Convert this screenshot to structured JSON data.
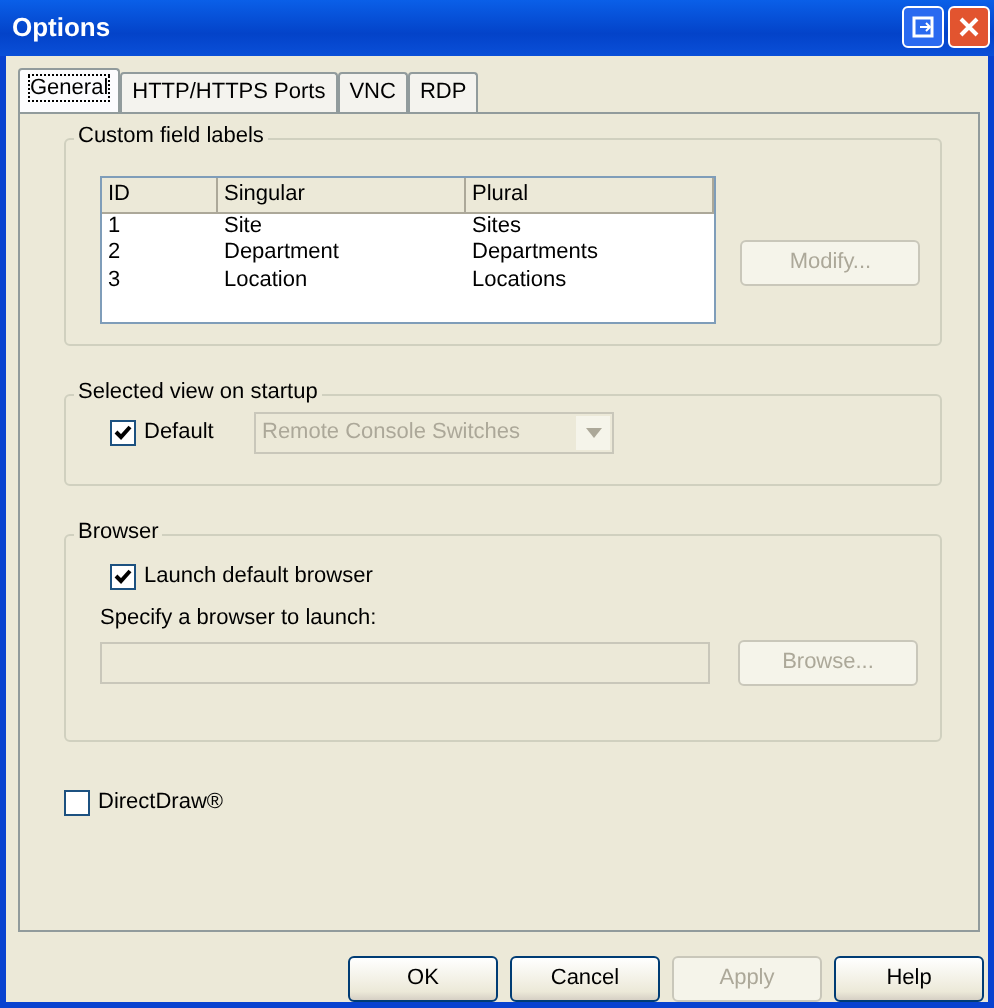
{
  "window": {
    "title": "Options"
  },
  "tabs": [
    {
      "label": "General",
      "selected": true
    },
    {
      "label": "HTTP/HTTPS Ports",
      "selected": false
    },
    {
      "label": "VNC",
      "selected": false
    },
    {
      "label": "RDP",
      "selected": false
    }
  ],
  "custom_field_labels": {
    "title": "Custom field labels",
    "columns": [
      "ID",
      "Singular",
      "Plural"
    ],
    "rows": [
      [
        "1",
        "Site",
        "Sites"
      ],
      [
        "2",
        "Department",
        "Departments"
      ],
      [
        "3",
        "Location",
        "Locations"
      ]
    ],
    "modify_button": {
      "label": "Modify...",
      "disabled": true
    }
  },
  "startup_view": {
    "title": "Selected view on startup",
    "default_checkbox": {
      "label": "Default",
      "checked": true
    },
    "view_select": {
      "value": "Remote Console Switches",
      "disabled": true
    }
  },
  "browser": {
    "title": "Browser",
    "launch_default": {
      "label": "Launch default browser",
      "checked": true
    },
    "specify_label": "Specify a browser to launch:",
    "path_field": {
      "disabled": true
    },
    "browse_button": {
      "label": "Browse...",
      "disabled": true
    }
  },
  "directdraw": {
    "label": "DirectDraw®",
    "checked": false
  },
  "buttons": [
    {
      "label": "OK",
      "disabled": false
    },
    {
      "label": "Cancel",
      "disabled": false
    },
    {
      "label": "Apply",
      "disabled": true
    },
    {
      "label": "Help",
      "disabled": false
    }
  ]
}
